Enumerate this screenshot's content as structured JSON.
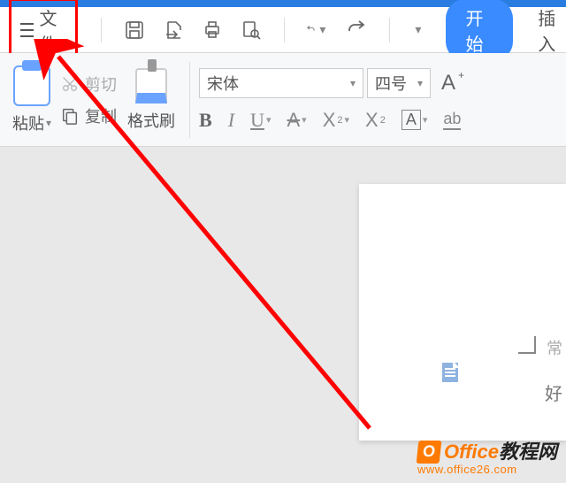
{
  "menubar": {
    "file_label": "文件",
    "start_label": "开始",
    "insert_label": "插入"
  },
  "ribbon": {
    "paste_label": "粘贴",
    "cut_label": "剪切",
    "copy_label": "复制",
    "format_painter_label": "格式刷",
    "font_name": "宋体",
    "font_size": "四号",
    "bold": "B",
    "italic": "I",
    "underline": "U",
    "letter_a": "A",
    "letter_x": "X",
    "sup2": "2",
    "ab": "ab"
  },
  "page": {
    "char1": "好",
    "char2": "常"
  },
  "watermark": {
    "badge": "O",
    "line1a": "Office",
    "line1b": "教程网",
    "line2": "www.office26.com"
  }
}
